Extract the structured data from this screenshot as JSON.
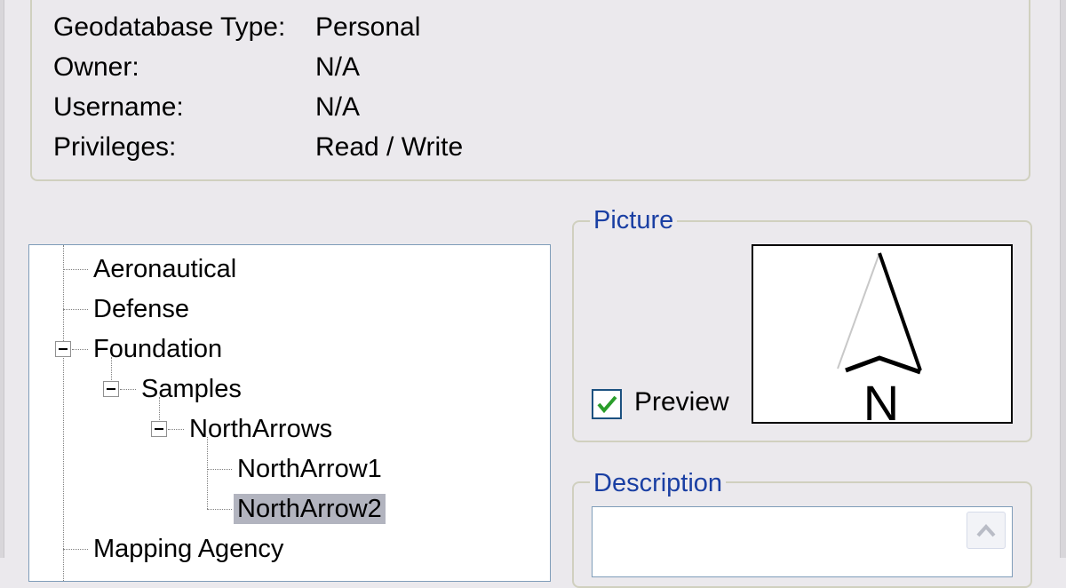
{
  "info": {
    "rows": [
      {
        "label": "Geodatabase Type:",
        "value": "Personal"
      },
      {
        "label": "Owner:",
        "value": "N/A"
      },
      {
        "label": "Username:",
        "value": "N/A"
      },
      {
        "label": "Privileges:",
        "value": "Read / Write"
      }
    ]
  },
  "tree": {
    "items": [
      {
        "label": "Aeronautical",
        "expanded": false,
        "selected": false
      },
      {
        "label": "Defense",
        "expanded": false,
        "selected": false
      },
      {
        "label": "Foundation",
        "expanded": true,
        "selected": false
      },
      {
        "label": "Samples",
        "expanded": true,
        "selected": false
      },
      {
        "label": "NorthArrows",
        "expanded": true,
        "selected": false
      },
      {
        "label": "NorthArrow1",
        "expanded": false,
        "selected": false
      },
      {
        "label": "NorthArrow2",
        "expanded": false,
        "selected": true
      },
      {
        "label": "Mapping Agency",
        "expanded": false,
        "selected": false
      }
    ]
  },
  "picture": {
    "legend": "Picture",
    "preview_label": "Preview",
    "preview_checked": true,
    "arrow_letter": "N"
  },
  "description": {
    "legend": "Description",
    "text": ""
  },
  "colors": {
    "legend_blue": "#1a3fa3",
    "selection": "#b2b4bf",
    "check_green": "#2a9d2a"
  }
}
